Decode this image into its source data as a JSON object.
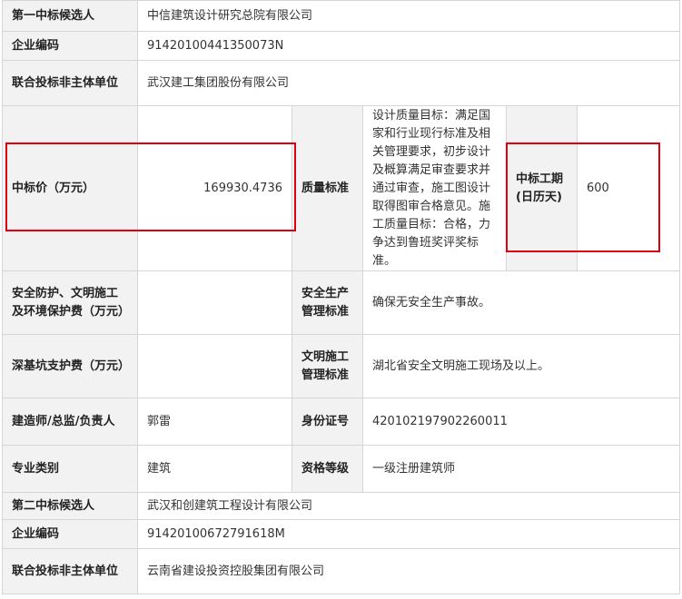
{
  "candidate1": {
    "rank_label": "第一中标候选人",
    "name": "中信建筑设计研究总院有限公司",
    "code_label": "企业编码",
    "code": "91420100441350073N",
    "partner_label": "联合投标非主体单位",
    "partner": "武汉建工集团股份有限公司",
    "price_label": "中标价（万元）",
    "price": "169930.4736",
    "quality_label": "质量标准",
    "quality": "设计质量目标：满足国家和行业现行标准及相关管理要求，初步设计及概算满足审查要求并通过审查，施工图设计取得图审合格意见。施工质量目标：合格，力争达到鲁班奖评奖标准。",
    "period_label": "中标工期(日历天)",
    "period": "600",
    "safety_fee_label": "安全防护、文明施工及环境保护费（万元）",
    "safety_fee": "",
    "safety_std_label": "安全生产管理标准",
    "safety_std": "确保无安全生产事故。",
    "pit_fee_label": "深基坑支护费（万元）",
    "pit_fee": "",
    "civil_std_label": "文明施工管理标准",
    "civil_std": "湖北省安全文明施工现场及以上。",
    "manager_label": "建造师/总监/负责人",
    "manager": "郭雷",
    "id_label": "身份证号",
    "id": "420102197902260011",
    "major_label": "专业类别",
    "major": "建筑",
    "qual_label": "资格等级",
    "qual": "一级注册建筑师"
  },
  "candidate2": {
    "rank_label": "第二中标候选人",
    "name": "武汉和创建筑工程设计有限公司",
    "code_label": "企业编码",
    "code": "91420100672791618M",
    "partner_label": "联合投标非主体单位",
    "partner": "云南省建设投资控股集团有限公司"
  },
  "highlight_color": "#e0000f"
}
